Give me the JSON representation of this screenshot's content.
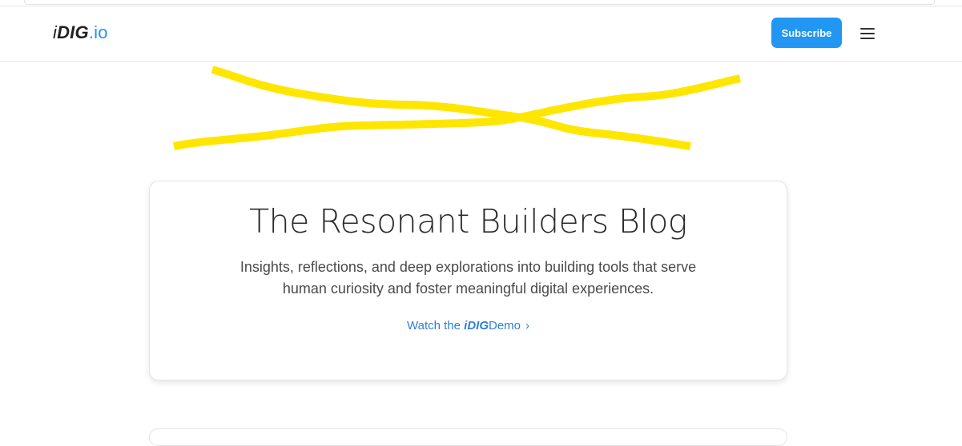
{
  "header": {
    "logo": {
      "prefix": "i",
      "bold": "DIG",
      "suffix": ".io"
    },
    "subscribe_label": "Subscribe",
    "menu_icon": "hamburger-menu-icon"
  },
  "hero": {
    "title": "The Resonant Builders Blog",
    "subtitle": "Insights, reflections, and deep explorations into building tools that serve human curiosity and foster meaningful digital experiences.",
    "demo_link": {
      "before": "Watch the ",
      "prefix": "i",
      "bold": "DIG",
      "after": "Demo",
      "chevron": "›"
    }
  },
  "colors": {
    "accent": "#2196f3",
    "link": "#2f7fd6",
    "scribble": "#ffe600"
  }
}
